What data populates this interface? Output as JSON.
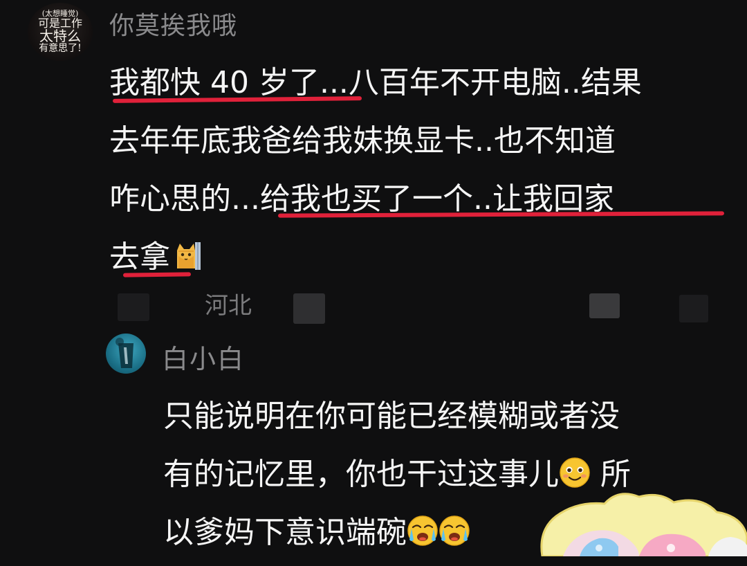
{
  "comment_1": {
    "avatar": {
      "line1": "(太想睡觉)",
      "line2": "可是工作",
      "line3": "太特么",
      "line4": "有意思了!"
    },
    "username": "你莫挨我哦",
    "lines": [
      {
        "underlined": "我都快 40 岁了...",
        "rest": "八百年不开电脑..结果"
      },
      {
        "text": "去年年底我爸给我妹换显卡..也不知道"
      },
      {
        "before": "咋心思的...",
        "underlined": "给我也买了一个..让我回家"
      },
      {
        "underlined": "去拿",
        "emoji": "peeking-cat-emoji"
      }
    ],
    "location": "河北"
  },
  "reply": {
    "username": "白小白",
    "lines": [
      {
        "text": "只能说明在你可能已经模糊或者没"
      },
      {
        "text": "有的记忆里，你也干过这事儿",
        "emoji": "smiling-face-emoji",
        "after": " 所"
      },
      {
        "text": "以爹妈下意识端碗",
        "emojis": [
          "crying-face-emoji",
          "crying-face-emoji"
        ]
      }
    ]
  },
  "colors": {
    "background": "#0f0f10",
    "text": "#f5f5f5",
    "muted": "#8a8a8c",
    "underline": "#e0213a"
  }
}
